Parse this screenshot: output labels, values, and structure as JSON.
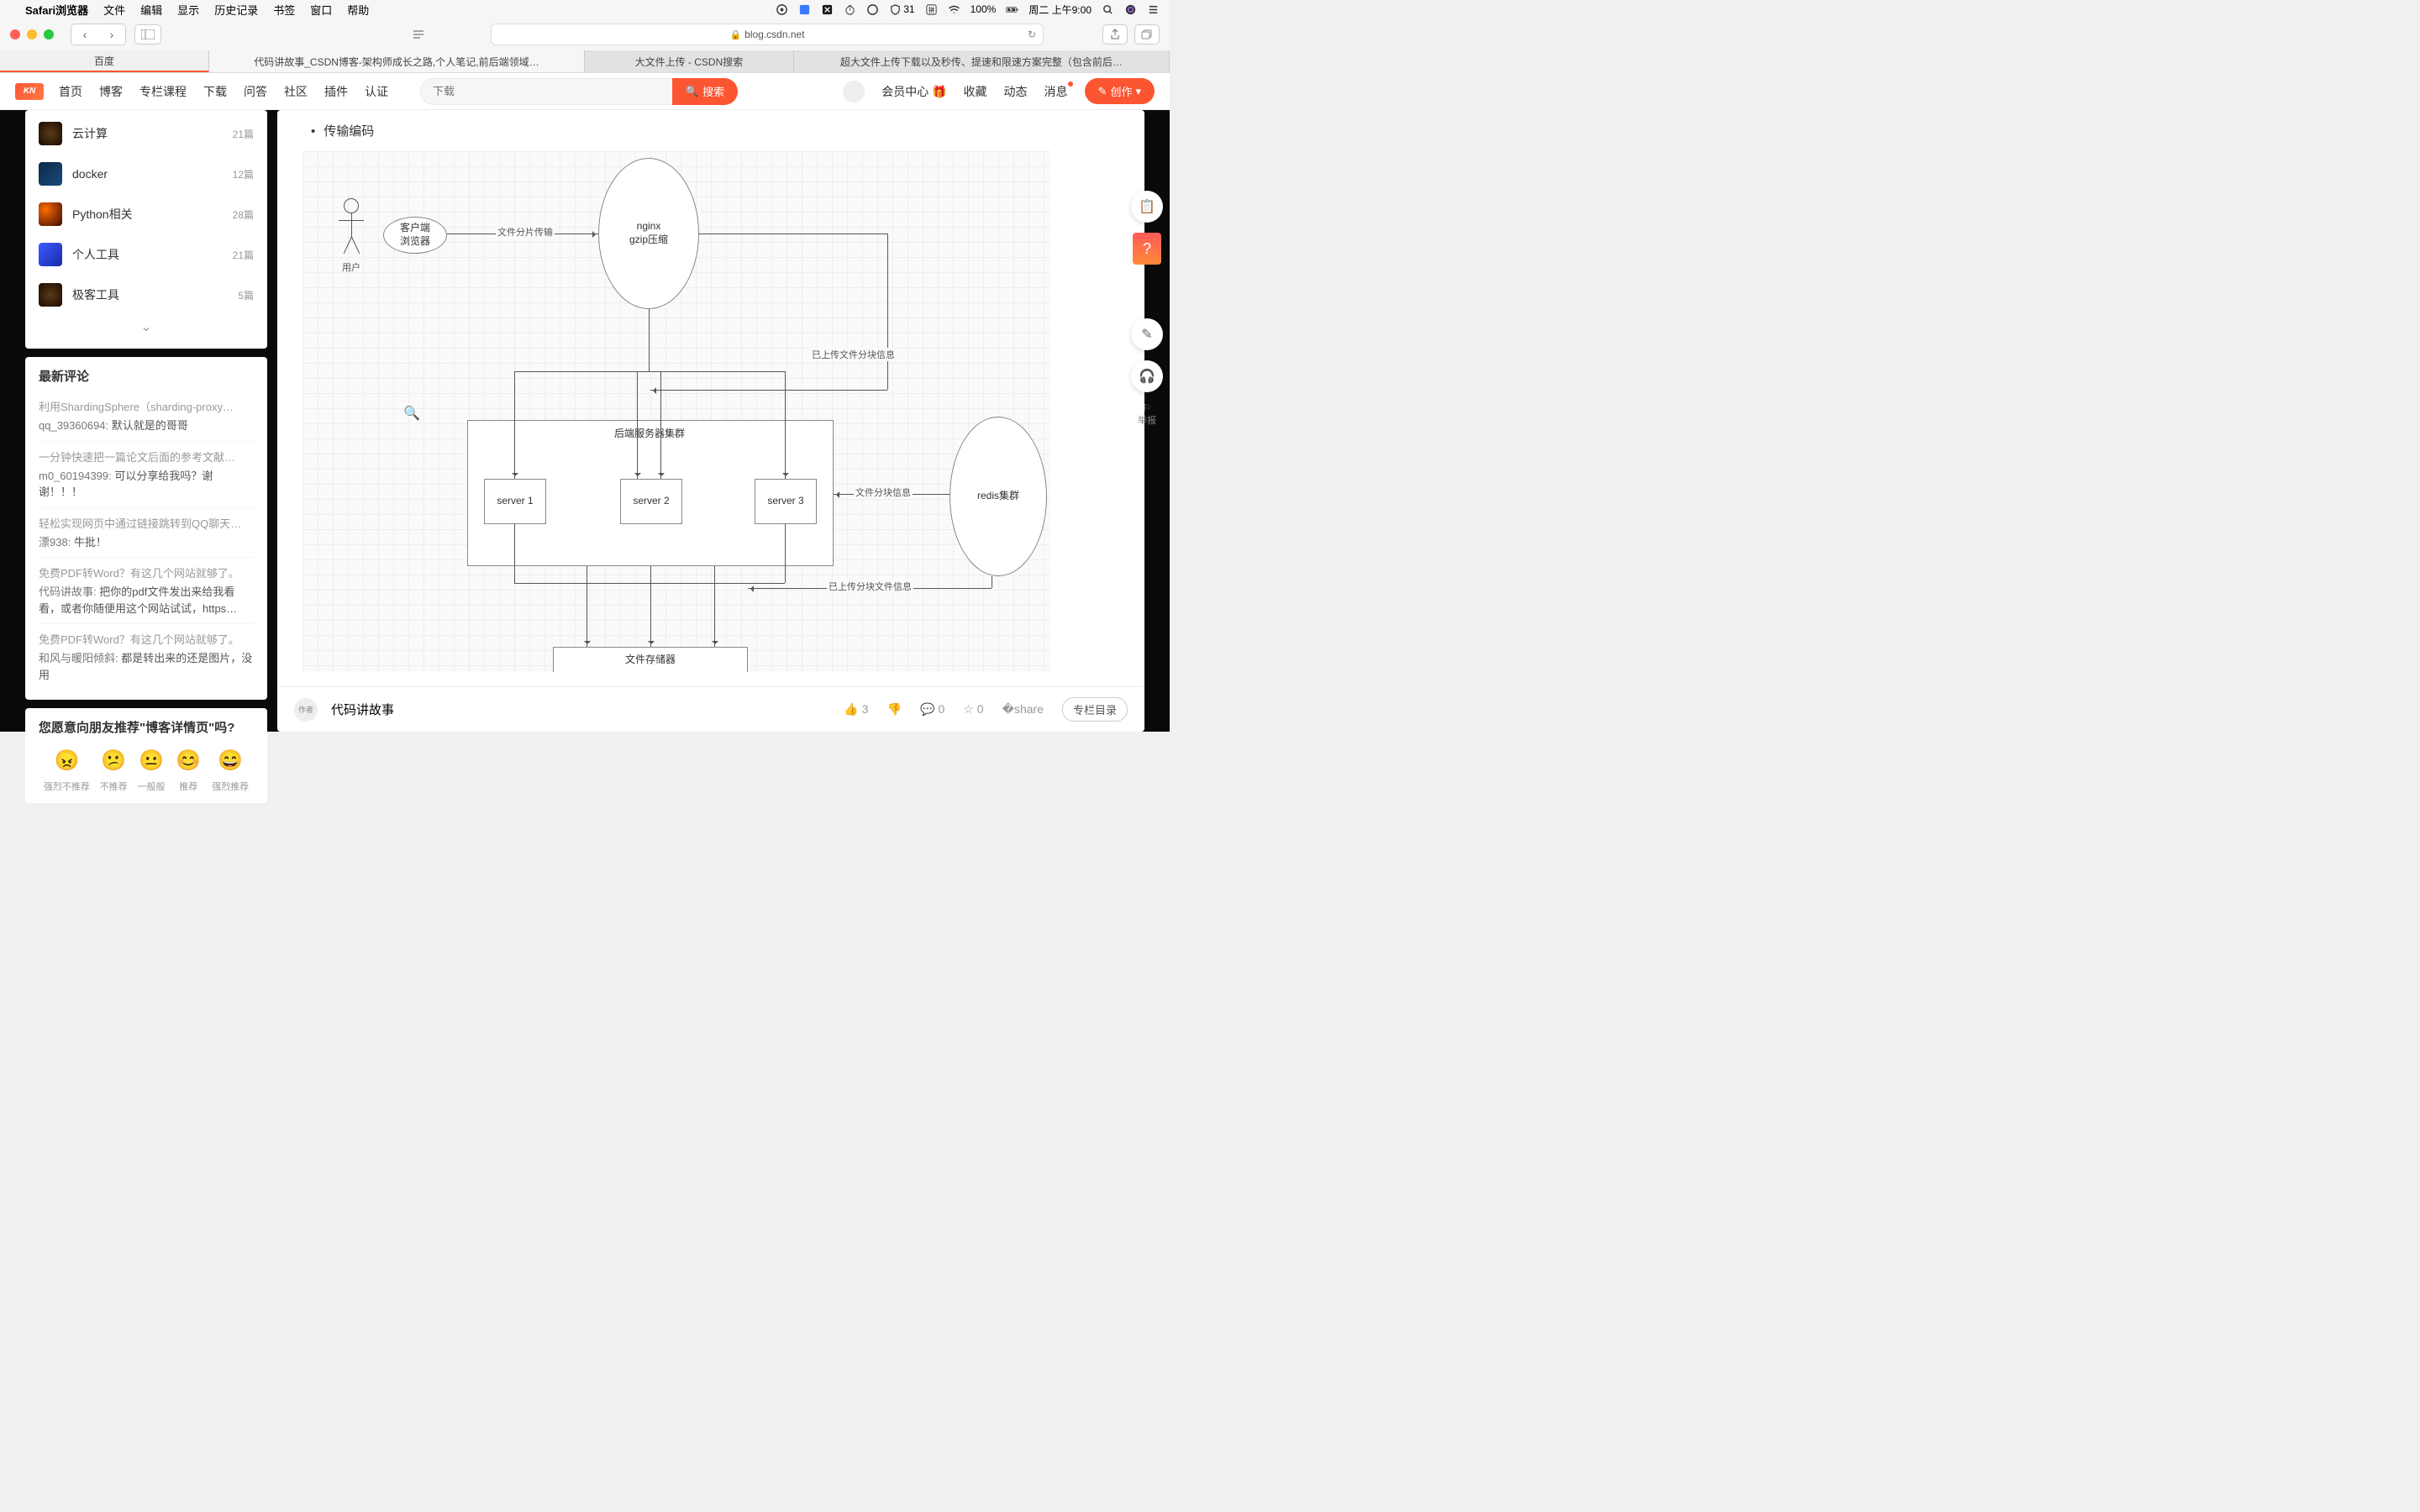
{
  "menubar": {
    "app": "Safari浏览器",
    "items": [
      "文件",
      "编辑",
      "显示",
      "历史记录",
      "书签",
      "窗口",
      "帮助"
    ],
    "badge_num": "31",
    "battery": "100%",
    "clock": "周二 上午9:00"
  },
  "browser": {
    "url": "blog.csdn.net",
    "tabs": [
      "百度",
      "代码讲故事_CSDN博客-架构师成长之路,个人笔记,前后端领域…",
      "大文件上传 - CSDN搜索",
      "超大文件上传下载以及秒传、提速和限速方案完整（包含前后…"
    ]
  },
  "header": {
    "nav": [
      "首页",
      "博客",
      "专栏课程",
      "下载",
      "问答",
      "社区",
      "插件",
      "认证"
    ],
    "search_placeholder": "下载",
    "search_btn": "搜索",
    "right": {
      "vip": "会员中心",
      "fav": "收藏",
      "feed": "动态",
      "msg": "消息",
      "write": "创作"
    }
  },
  "sidebar": {
    "categories": [
      {
        "name": "云计算",
        "count": "21篇"
      },
      {
        "name": "docker",
        "count": "12篇"
      },
      {
        "name": "Python相关",
        "count": "28篇"
      },
      {
        "name": "个人工具",
        "count": "21篇"
      },
      {
        "name": "极客工具",
        "count": "5篇"
      }
    ],
    "comments_title": "最新评论",
    "comments": [
      {
        "title": "利用ShardingSphere（sharding-proxy…",
        "user": "qq_39360694:",
        "body": "默认就是的哥哥"
      },
      {
        "title": "一分钟快速把一篇论文后面的参考文献…",
        "user": "m0_60194399:",
        "body": "可以分享给我吗？谢谢！！！"
      },
      {
        "title": "轻松实现网页中通过链接跳转到QQ聊天…",
        "user": "漂938:",
        "body": "牛批！"
      },
      {
        "title": "免费PDF转Word？有这几个网站就够了。",
        "user": "代码讲故事:",
        "body": "把你的pdf文件发出来给我看看，或者你随便用这个网站试试，https…"
      },
      {
        "title": "免费PDF转Word？有这几个网站就够了。",
        "user": "和风与暖阳倾斜:",
        "body": "都是转出来的还是图片，没用"
      }
    ],
    "recommend_title": "您愿意向朋友推荐\"博客详情页\"吗?",
    "emojis": [
      {
        "face": "😠",
        "lbl": "强烈不推荐"
      },
      {
        "face": "😕",
        "lbl": "不推荐"
      },
      {
        "face": "😐",
        "lbl": "一般般"
      },
      {
        "face": "😊",
        "lbl": "推荐"
      },
      {
        "face": "😄",
        "lbl": "强烈推荐"
      }
    ]
  },
  "article": {
    "bullet1": "传输编码"
  },
  "diagram": {
    "user": "用户",
    "client": "客户端\n浏览器",
    "nginx": "nginx\ngzip压缩",
    "cluster": "后端服务器集群",
    "s1": "server 1",
    "s2": "server 2",
    "s3": "server 3",
    "redis": "redis集群",
    "storage": "文件存储器",
    "l_upload": "文件分片传输",
    "l_uploaded": "已上传文件分块信息",
    "l_chunk": "文件分块信息",
    "l_uploaded2": "已上传分块文件信息"
  },
  "bottom": {
    "author": "代码讲故事",
    "like": "3",
    "comment": "0",
    "star": "0",
    "catalog": "专栏目录"
  },
  "float": {
    "report": "举报"
  }
}
